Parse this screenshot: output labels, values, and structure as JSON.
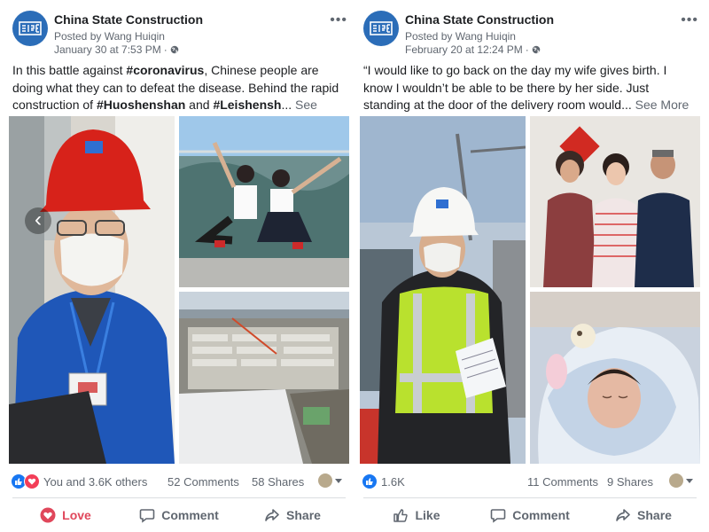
{
  "colors": {
    "brand_blue": "#2b6db8",
    "like_blue": "#1877f2",
    "love_red": "#e0475b",
    "secondary_text": "#606770",
    "divider": "#dadde1"
  },
  "posts": [
    {
      "page_name": "China State Construction",
      "posted_by": "Posted by Wang Huiqin",
      "timestamp": "January 30 at 7:53 PM",
      "meta_sep": "·",
      "audience_icon": "globe-icon",
      "more_icon": "•••",
      "text": {
        "p1": "In this battle against ",
        "tag1": "#coronavirus",
        "p2": ", Chinese people are doing what they can to defeat the disease. Behind the rapid construction of ",
        "tag2": "#Huoshenshan",
        "p3": " and ",
        "tag3": "#Leishensh",
        "ellipsis": "... ",
        "see_more": "See More"
      },
      "reactions": {
        "icons": [
          "like-icon",
          "love-icon"
        ],
        "text": "You and 3.6K others"
      },
      "comments": "52 Comments",
      "shares": "58 Shares",
      "actions": {
        "react": "Love",
        "comment": "Comment",
        "share": "Share"
      },
      "carousel_prev_icon": "‹"
    },
    {
      "page_name": "China State Construction",
      "posted_by": "Posted by Wang Huiqin",
      "timestamp": "February 20 at 12:24 PM",
      "meta_sep": "·",
      "audience_icon": "globe-icon",
      "more_icon": "•••",
      "text": {
        "p1": "“I would like to go back on the day my wife gives birth. I know I wouldn’t be able to be there by her side. Just standing at the door of the delivery room would",
        "ellipsis": "... ",
        "see_more": "See More"
      },
      "reactions": {
        "icons": [
          "like-icon"
        ],
        "text": "1.6K"
      },
      "comments": "11 Comments",
      "shares": "9 Shares",
      "actions": {
        "react": "Like",
        "comment": "Comment",
        "share": "Share"
      }
    }
  ]
}
